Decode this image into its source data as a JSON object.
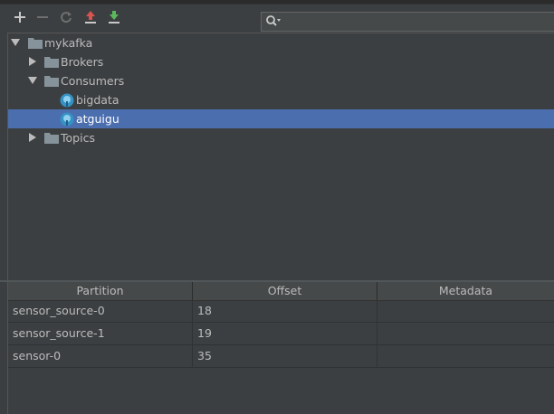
{
  "toolbar": {
    "buttons": [
      {
        "name": "add-icon",
        "color": "#c8c8c8"
      },
      {
        "name": "remove-icon",
        "color": "#6e6e6e"
      },
      {
        "name": "refresh-icon",
        "color": "#6e6e6e"
      },
      {
        "name": "upload-icon",
        "color": "#d9534f"
      },
      {
        "name": "download-icon",
        "color": "#5cb85c"
      }
    ],
    "search_placeholder": ""
  },
  "tree": {
    "items": [
      {
        "label": "mykafka",
        "icon": "folder-icon",
        "expanded": true
      },
      {
        "label": "Brokers",
        "icon": "folder-icon",
        "expanded": false
      },
      {
        "label": "Consumers",
        "icon": "folder-icon",
        "expanded": true
      },
      {
        "label": "bigdata",
        "icon": "consumer-icon"
      },
      {
        "label": "atguigu",
        "icon": "consumer-icon",
        "selected": true
      },
      {
        "label": "Topics",
        "icon": "folder-icon",
        "expanded": false
      }
    ]
  },
  "table": {
    "columns": [
      "Partition",
      "Offset",
      "Metadata"
    ],
    "rows": [
      [
        "sensor_source-0",
        "18",
        ""
      ],
      [
        "sensor_source-1",
        "19",
        ""
      ],
      [
        "sensor-0",
        "35",
        ""
      ]
    ]
  },
  "colors": {
    "background": "#3c3f41",
    "selection": "#4b6eaf",
    "folder": "#87939a",
    "consumer": "#3592c4"
  }
}
